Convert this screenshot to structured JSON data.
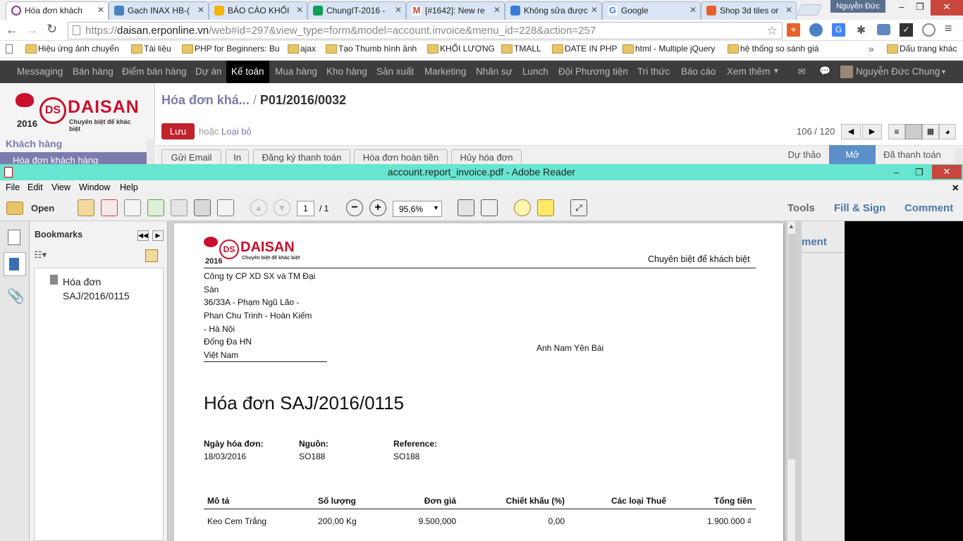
{
  "browser": {
    "tabs": [
      {
        "label": "Hóa đơn khách",
        "color": "#8b3a8f",
        "active": true
      },
      {
        "label": "Gạch INAX HB-(",
        "color": "#4a7fc1"
      },
      {
        "label": "BÁO CÁO KHỐI",
        "color": "#f4b400"
      },
      {
        "label": "ChungIT-2016 -",
        "color": "#0f9d58"
      },
      {
        "label": "[#1642]: New re",
        "color": "#c4463a"
      },
      {
        "label": "Không sửa được",
        "color": "#3b7bd8"
      },
      {
        "label": "Google",
        "color": "#4285f4"
      },
      {
        "label": "Shop 3d tiles or",
        "color": "#e8612c"
      }
    ],
    "user_badge": "Nguyễn Đức",
    "url_prefix": "https://",
    "url_domain": "daisan.erponline.vn",
    "url_rest": "/web#id=297&view_type=form&model=account.invoice&menu_id=228&action=257",
    "bookmarks": [
      "Hiệu ứng ảnh chuyển",
      "Tài liệu",
      "PHP for Beginners: Bu",
      "ajax",
      "Tạo Thumb hình ảnh",
      "KHỐI LƯỢNG",
      "TMALL",
      "DATE IN PHP",
      "html - Multiple jQuery",
      "hệ thống so sánh giá",
      "Dấu trang khác"
    ],
    "bookmarks_overflow": "»"
  },
  "odoo": {
    "menu": [
      "Messaging",
      "Bán hàng",
      "Điểm bán hàng",
      "Dự án",
      "Kế toán",
      "Mua hàng",
      "Kho hàng",
      "Sản xuất",
      "Marketing",
      "Nhân sự",
      "Lunch",
      "Đội Phương tiện",
      "Tri thức",
      "Báo cáo",
      "Xem thêm"
    ],
    "active_menu": "Kế toán",
    "user_name": "Nguyễn Đức Chung",
    "logo_text": "DAISAN",
    "logo_year": "2016",
    "logo_tagline": "Chuyên biệt để khác biệt",
    "sidebar_section": "Khách hàng",
    "sidebar_item": "Hóa đơn khách hàng",
    "breadcrumb_parent": "Hóa đơn khá...",
    "breadcrumb_sep": "/",
    "breadcrumb_current": "P01/2016/0032",
    "save_label": "Lưu",
    "or_label": "hoặc",
    "discard_label": "Loại bỏ",
    "pager": "106 / 120",
    "action_buttons": [
      "Gửi Email",
      "In",
      "Đăng ký thanh toán",
      "Hóa đơn hoàn tiền",
      "Hủy hóa đơn"
    ],
    "status_steps": [
      "Dự thảo",
      "Mở",
      "Đã thanh toán"
    ],
    "status_active": "Mở"
  },
  "reader": {
    "title": "account.report_invoice.pdf - Adobe Reader",
    "menu": [
      "File",
      "Edit",
      "View",
      "Window",
      "Help"
    ],
    "open_label": "Open",
    "page_current": "1",
    "page_total": "/ 1",
    "zoom": "95,6%",
    "tools_labels": [
      "Tools",
      "Fill & Sign",
      "Comment"
    ],
    "bookmarks_title": "Bookmarks",
    "bookmark_item": "Hóa đơn SAJ/2016/0115",
    "comment_partial": "ment"
  },
  "invoice": {
    "logo_text": "DAISAN",
    "logo_year": "2016",
    "logo_tagline": "Chuyên biệt để khác biệt",
    "tagline": "Chuyên biệt để khách biệt",
    "company_lines": [
      "Công ty CP XD SX và TM Đại",
      "Sàn",
      "36/33A - Phạm Ngũ Lão -",
      "Phan Chu Trinh - Hoàn Kiếm",
      "- Hà Nội",
      "Đống Đa HN",
      "Việt Nam"
    ],
    "customer": "Anh Nam Yên Bái",
    "title": "Hóa đơn SAJ/2016/0115",
    "meta": [
      {
        "label": "Ngày hóa đơn:",
        "value": "18/03/2016"
      },
      {
        "label": "Nguồn:",
        "value": "SO188"
      },
      {
        "label": "Reference:",
        "value": "SO188"
      }
    ],
    "table_headers": [
      "Mô tả",
      "Số lượng",
      "Đơn giá",
      "Chiết khấu (%)",
      "Các loại Thuế",
      "Tổng tiền"
    ],
    "rows": [
      {
        "desc": "Keo Cem Trắng",
        "qty": "200,00 Kg",
        "price": "9.500,000",
        "discount": "0,00",
        "tax": "",
        "total": "1.900.000 ₫"
      }
    ]
  }
}
